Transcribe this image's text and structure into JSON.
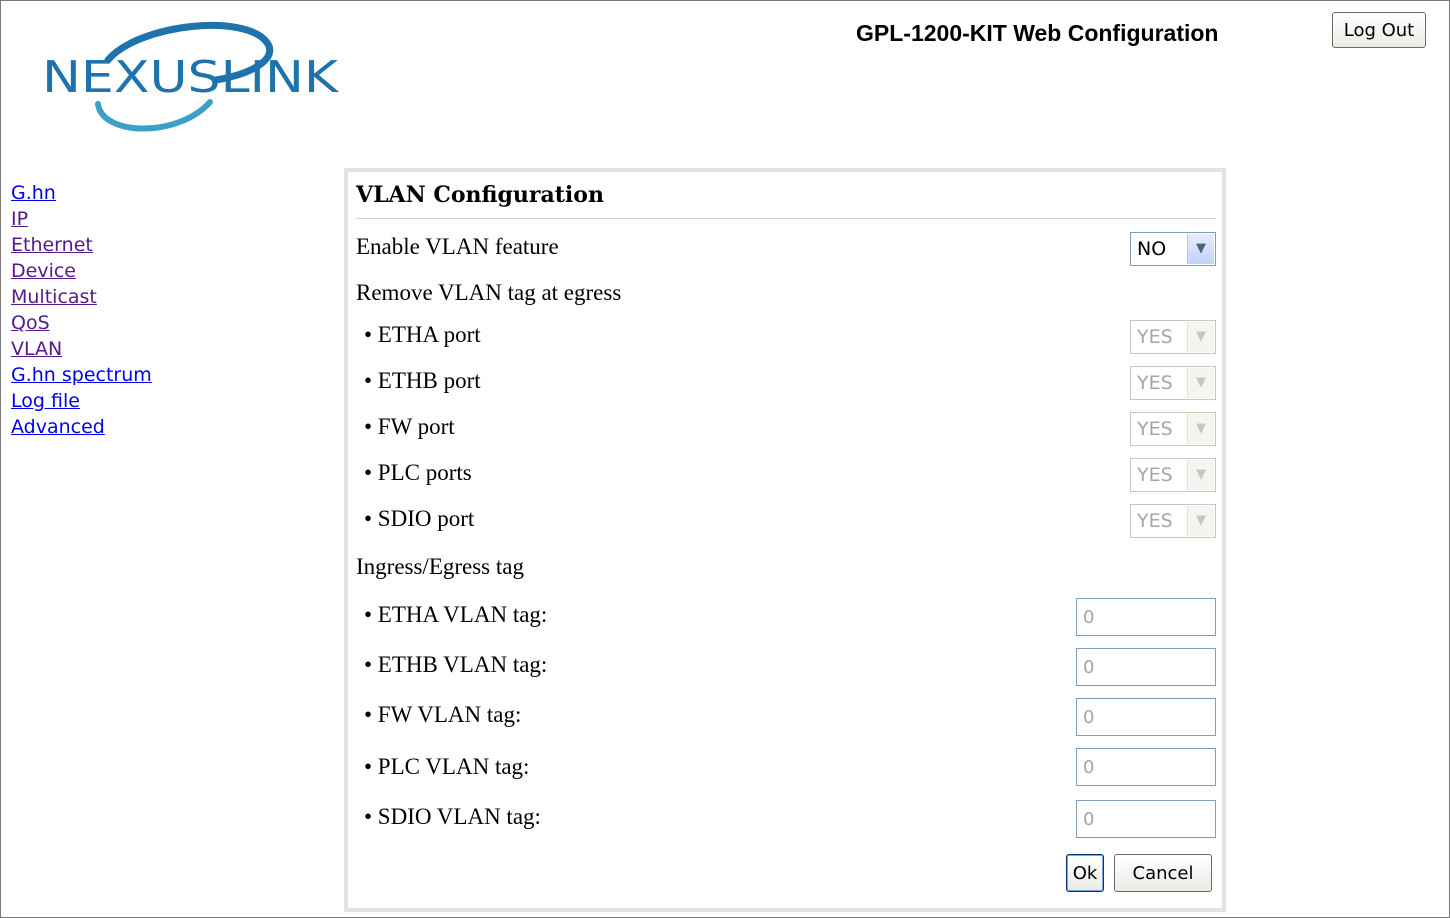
{
  "header": {
    "brand_logo": "NEXUSLINK",
    "title": "GPL-1200-KIT Web Configuration",
    "logout_label": "Log Out",
    "brand_color": "#1e73ad"
  },
  "sidebar": {
    "items": [
      {
        "label": "G.hn",
        "state": "unvisited"
      },
      {
        "label": "IP",
        "state": "visited"
      },
      {
        "label": "Ethernet",
        "state": "visited"
      },
      {
        "label": "Device",
        "state": "visited"
      },
      {
        "label": "Multicast",
        "state": "visited"
      },
      {
        "label": "QoS",
        "state": "visited"
      },
      {
        "label": "VLAN",
        "state": "visited"
      },
      {
        "label": "G.hn spectrum",
        "state": "unvisited"
      },
      {
        "label": "Log file",
        "state": "unvisited"
      },
      {
        "label": "Advanced",
        "state": "unvisited"
      }
    ]
  },
  "panel": {
    "title": "VLAN Configuration",
    "enable": {
      "label": "Enable VLAN feature",
      "value": "NO"
    },
    "remove_section": "Remove VLAN tag at egress",
    "remove_rows": [
      {
        "label": "• ETHA port",
        "value": "YES"
      },
      {
        "label": "• ETHB port",
        "value": "YES"
      },
      {
        "label": "• FW port",
        "value": "YES"
      },
      {
        "label": "• PLC ports",
        "value": "YES"
      },
      {
        "label": "• SDIO port",
        "value": "YES"
      }
    ],
    "tag_section": "Ingress/Egress tag",
    "tag_rows": [
      {
        "label": "• ETHA VLAN tag:",
        "value": "0"
      },
      {
        "label": "• ETHB VLAN tag:",
        "value": "0"
      },
      {
        "label": "• FW VLAN tag:",
        "value": "0"
      },
      {
        "label": "• PLC VLAN tag:",
        "value": "0"
      },
      {
        "label": "• SDIO VLAN tag:",
        "value": "0"
      }
    ],
    "ok_label": "Ok",
    "cancel_label": "Cancel"
  }
}
